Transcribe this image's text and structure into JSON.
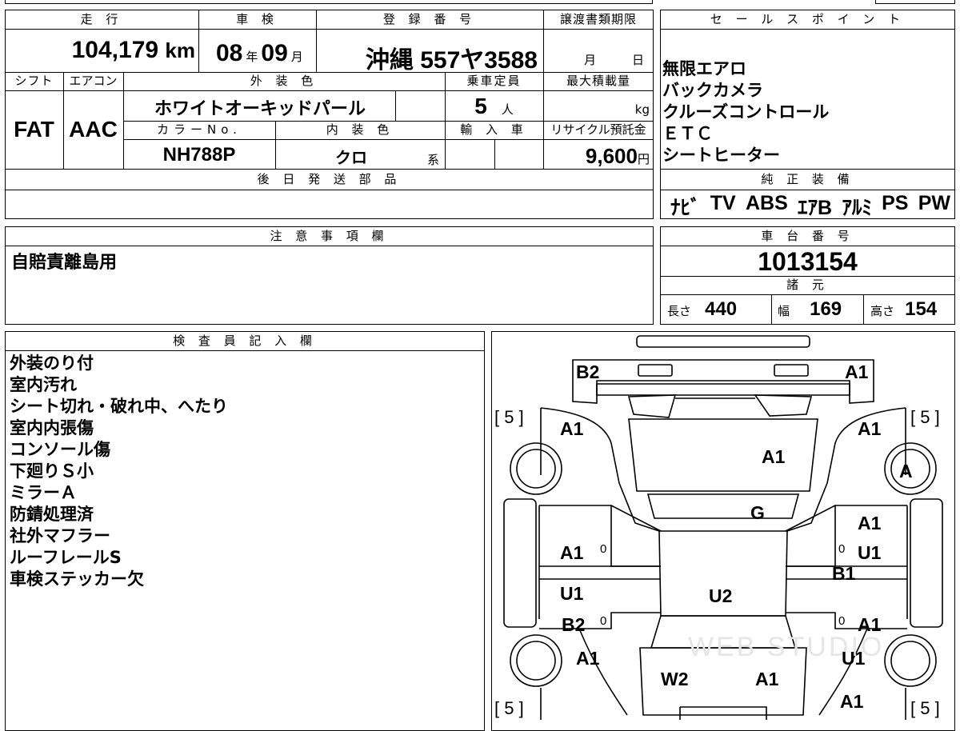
{
  "top": {
    "mileage_label": "走 行",
    "mileage_value": "104,179",
    "mileage_unit": "km",
    "inspection_label": "車 検",
    "inspection_year": "08",
    "inspection_year_unit": "年",
    "inspection_month": "09",
    "inspection_month_unit": "月",
    "registration_label": "登 録 番 号",
    "registration_value": "沖縄 557ヤ3588",
    "transfer_label": "譲渡書類期限",
    "transfer_month_unit": "月",
    "transfer_day_unit": "日"
  },
  "row2": {
    "shift_label": "シフト",
    "shift_value": "FAT",
    "ac_label": "エアコン",
    "ac_value": "AAC",
    "exterior_label": "外 装 色",
    "exterior_value": "ホワイトオーキッドパール",
    "capacity_label": "乗車定員",
    "capacity_value": "5",
    "capacity_unit": "人",
    "maxload_label": "最大積載量",
    "maxload_unit": "kg",
    "colorno_label": "カラーNo.",
    "colorno_value": "NH788P",
    "interior_label": "内 装 色",
    "interior_value": "クロ",
    "interior_unit": "系",
    "import_label": "輸 入 車",
    "recycle_label": "リサイクル預託金",
    "recycle_value": "9,600",
    "recycle_unit": "円"
  },
  "later_parts": {
    "label": "後 日 発 送 部 品"
  },
  "sales_points": {
    "label": "セ ー ル ス ポ イ ン ト",
    "items": [
      "無限エアロ",
      "バックカメラ",
      "クルーズコントロール",
      "ＥＴＣ",
      "シートヒーター"
    ]
  },
  "equipment": {
    "label": "純 正 装 備",
    "items": [
      "ﾅﾋﾞ",
      "TV",
      "ABS",
      "ｴｱB",
      "ｱﾙﾐ",
      "PS",
      "PW"
    ]
  },
  "notes": {
    "label": "注 意 事 項 欄",
    "text": "自賠責離島用"
  },
  "chassis": {
    "label": "車 台 番 号",
    "value": "1013154"
  },
  "specs": {
    "label": "諸 元",
    "length_label": "長さ",
    "length_value": "440",
    "width_label": "幅",
    "width_value": "169",
    "height_label": "高さ",
    "height_value": "154"
  },
  "inspector": {
    "label": "検 査 員 記 入 欄",
    "lines": [
      "外装のり付",
      "室内汚れ",
      "シート切れ・破れ中、へたり",
      "室内内張傷",
      "コンソール傷",
      "下廻りＳ小",
      "ミラーＡ",
      "防錆処理済",
      "社外マフラー",
      "ルーフレールS",
      "車検ステッカー欠"
    ]
  },
  "diagram": {
    "marks": {
      "rear_left": "B2",
      "rear_right": "A1",
      "quarter_left": "A1",
      "quarter_right": "A1",
      "tailgate": "A1",
      "tire_right_rear": "A",
      "back_glass": "G",
      "right_rear_upper": "A1",
      "left_rear_door": "A1",
      "right_rear_door": "U1",
      "right_pillar": "B1",
      "left_front_door_top": "U1",
      "roof": "U2",
      "left_front_door": "B2",
      "right_front_door": "A1",
      "left_fender": "A1",
      "right_fender": "U1",
      "hood": "W2",
      "hood_right": "A1",
      "front_right": "A1"
    },
    "tire_brackets": [
      "[ 5 ]",
      "[ 5 ]",
      "[ 5 ]",
      "[ 5 ]"
    ],
    "zero_marks": [
      "0",
      "0",
      "0",
      "0"
    ],
    "watermark": "WEB STUDIO"
  }
}
